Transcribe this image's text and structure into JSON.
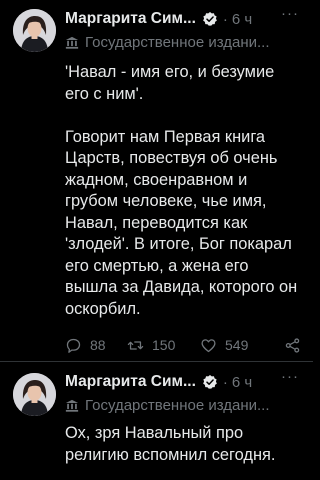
{
  "tweets": [
    {
      "author_name": "Маргарита Сим...",
      "time_separator": "·",
      "time": "6 ч",
      "more": "···",
      "state_label": "Государственное издани...",
      "text": "'Навал - имя его, и безумие его с ним'.\n\nГоворит нам Первая книга Царств, повествуя об очень жадном, своенравном и грубом человеке, чье имя, Навал, переводится как 'злодей'. В итоге, Бог покарал его смертью, а жена его вышла за Давида, которого он оскорбил.",
      "replies": "88",
      "retweets": "150",
      "likes": "549"
    },
    {
      "author_name": "Маргарита Сим...",
      "time_separator": "·",
      "time": "6 ч",
      "more": "···",
      "state_label": "Государственное издани...",
      "text": "Ох, зря Навальный про религию вспомнил сегодня."
    }
  ],
  "colors": {
    "background": "#000000",
    "text": "#e7e9ea",
    "muted": "#71767b",
    "verified_badge": "#e7e9ea",
    "divider": "#2f3336"
  },
  "icons": [
    "avatar",
    "verified-icon",
    "state-media-icon",
    "reply-icon",
    "retweet-icon",
    "like-icon",
    "share-icon",
    "more-icon"
  ]
}
